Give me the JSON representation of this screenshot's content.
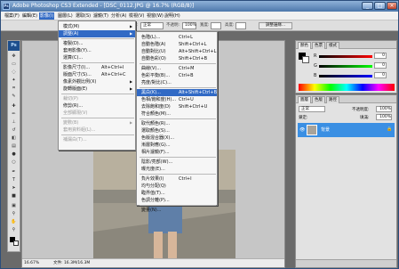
{
  "window": {
    "title": "Adobe Photoshop CS3 Extended - [DSC_0112.JPG @ 16.7% (RGB/8)]",
    "app_icon": "Ps",
    "min": "_",
    "max": "□",
    "close": "×"
  },
  "menubar": [
    "檔案(F)",
    "編輯(E)",
    "影像(I)",
    "圖層(L)",
    "選取(S)",
    "濾鏡(T)",
    "分析(A)",
    "檢視(V)",
    "視窗(W)",
    "說明(H)"
  ],
  "optbar": {
    "mode_label": "模式:",
    "mode_value": "正常",
    "opacity_label": "不透明:",
    "opacity_value": "100%",
    "width_label": "寬度:",
    "height_label": "高度:",
    "adjust_button": "調整邊緣...",
    "workspace": "工作區"
  },
  "image_menu": {
    "items": [
      {
        "label": "模式(M)",
        "shortcut": "",
        "arrow": true,
        "disabled": false
      },
      {
        "label": "調整(A)",
        "shortcut": "",
        "arrow": true,
        "disabled": false,
        "highlighted": true
      },
      {
        "label": "複製(D)...",
        "shortcut": "",
        "disabled": false
      },
      {
        "label": "套用影像(Y)...",
        "shortcut": "",
        "disabled": false
      },
      {
        "label": "運算(C)...",
        "shortcut": "",
        "disabled": false
      },
      {
        "label": "影像尺寸(I)...",
        "shortcut": "Alt+Ctrl+I",
        "disabled": false
      },
      {
        "label": "版面尺寸(S)...",
        "shortcut": "Alt+Ctrl+C",
        "disabled": false
      },
      {
        "label": "像素外觀比例(X)",
        "shortcut": "",
        "arrow": true,
        "disabled": false
      },
      {
        "label": "旋轉版面(E)",
        "shortcut": "",
        "arrow": true,
        "disabled": false
      },
      {
        "label": "裁切(P)",
        "shortcut": "",
        "disabled": true
      },
      {
        "label": "修剪(R)...",
        "shortcut": "",
        "disabled": false
      },
      {
        "label": "全部顯現(V)",
        "shortcut": "",
        "disabled": true
      },
      {
        "label": "變數(B)",
        "shortcut": "",
        "arrow": true,
        "disabled": true
      },
      {
        "label": "套用資料組(L)...",
        "shortcut": "",
        "disabled": true
      },
      {
        "label": "補漏白(T)...",
        "shortcut": "",
        "disabled": true
      }
    ]
  },
  "adjust_menu": {
    "items": [
      {
        "label": "色階(L)...",
        "shortcut": "Ctrl+L"
      },
      {
        "label": "自動色階(A)",
        "shortcut": "Shift+Ctrl+L"
      },
      {
        "label": "自動對比(U)",
        "shortcut": "Alt+Shift+Ctrl+L"
      },
      {
        "label": "自動色彩(O)",
        "shortcut": "Shift+Ctrl+B"
      },
      {
        "label": "曲線(V)...",
        "shortcut": "Ctrl+M"
      },
      {
        "label": "色彩平衡(B)...",
        "shortcut": "Ctrl+B"
      },
      {
        "label": "亮度/對比(C)...",
        "shortcut": ""
      },
      {
        "label": "黑白(K)...",
        "shortcut": "Alt+Shift+Ctrl+B",
        "highlighted": true
      },
      {
        "label": "色相/飽和度(H)...",
        "shortcut": "Ctrl+U"
      },
      {
        "label": "去除飽和度(D)",
        "shortcut": "Shift+Ctrl+U"
      },
      {
        "label": "符合顏色(M)...",
        "shortcut": ""
      },
      {
        "label": "取代顏色(R)...",
        "shortcut": ""
      },
      {
        "label": "選取顏色(S)...",
        "shortcut": ""
      },
      {
        "label": "色版混合器(X)...",
        "shortcut": ""
      },
      {
        "label": "漸層對應(G)...",
        "shortcut": ""
      },
      {
        "label": "相片濾鏡(F)...",
        "shortcut": ""
      },
      {
        "label": "陰影/亮部(W)...",
        "shortcut": ""
      },
      {
        "label": "曝光度(E)...",
        "shortcut": ""
      },
      {
        "label": "負片效果(I)",
        "shortcut": "Ctrl+I"
      },
      {
        "label": "均勻分配(Q)",
        "shortcut": ""
      },
      {
        "label": "臨界值(T)...",
        "shortcut": ""
      },
      {
        "label": "色調分離(P)...",
        "shortcut": ""
      },
      {
        "label": "變量(N)...",
        "shortcut": ""
      }
    ]
  },
  "color_panel": {
    "tabs": [
      "顏色",
      "色票",
      "樣式"
    ],
    "channels": [
      {
        "letter": "R",
        "value": "0"
      },
      {
        "letter": "G",
        "value": "0"
      },
      {
        "letter": "B",
        "value": "0"
      }
    ]
  },
  "layers_panel": {
    "tabs": [
      "圖層",
      "色版",
      "路徑"
    ],
    "blend": "正常",
    "opacity_label": "不透明度:",
    "opacity": "100%",
    "lock_label": "鎖定:",
    "fill_label": "填滿:",
    "fill": "100%",
    "layer_name": "背景"
  },
  "status": {
    "zoom": "16.67%",
    "doc": "文件: 16.3M/16.3M"
  },
  "colors": {
    "accent": "#316ac5",
    "layer_selected": "#3a8fe3"
  }
}
